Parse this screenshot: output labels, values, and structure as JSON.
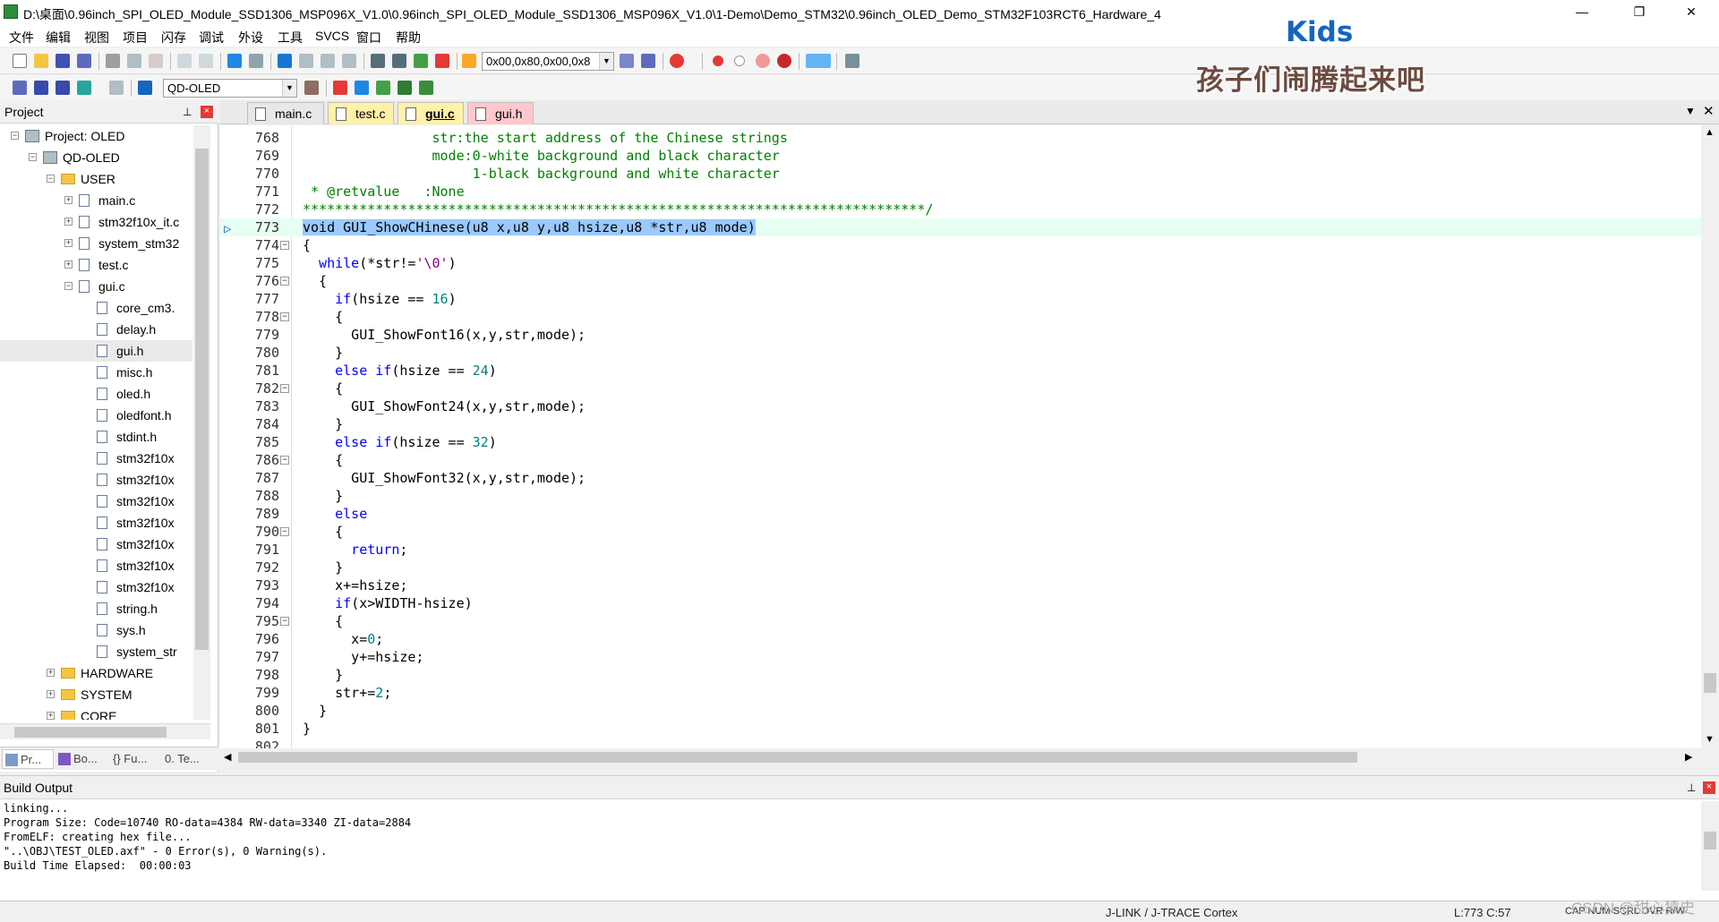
{
  "window": {
    "title": "D:\\桌面\\0.96inch_SPI_OLED_Module_SSD1306_MSP096X_V1.0\\0.96inch_SPI_OLED_Module_SSD1306_MSP096X_V1.0\\1-Demo\\Demo_STM32\\0.96inch_OLED_Demo_STM32F103RCT6_Hardware_4",
    "minimize": "—",
    "restore": "❐",
    "close": "✕"
  },
  "menu": [
    "文件",
    "编辑",
    "视图",
    "项目",
    "闪存",
    "调试",
    "外设",
    "工具",
    "SVCS",
    "窗口",
    "帮助"
  ],
  "toolbar": {
    "search_combo": "0x00,0x80,0x00,0x8",
    "target_combo": "QD-OLED"
  },
  "overlay": {
    "kids": "Kids",
    "kids_cn": "孩子们闹腾起来吧"
  },
  "project_panel": {
    "title": "Project",
    "pin": "📌",
    "close": "×",
    "tree": [
      {
        "label": "Project: OLED",
        "level": 0,
        "type": "proj",
        "exp": "−"
      },
      {
        "label": "QD-OLED",
        "level": 1,
        "type": "proj",
        "exp": "−"
      },
      {
        "label": "USER",
        "level": 2,
        "type": "folder",
        "exp": "−"
      },
      {
        "label": "main.c",
        "level": 3,
        "type": "file",
        "exp": "+"
      },
      {
        "label": "stm32f10x_it.c",
        "level": 3,
        "type": "file",
        "exp": "+"
      },
      {
        "label": "system_stm32",
        "level": 3,
        "type": "file",
        "exp": "+"
      },
      {
        "label": "test.c",
        "level": 3,
        "type": "file",
        "exp": "+"
      },
      {
        "label": "gui.c",
        "level": 3,
        "type": "file",
        "exp": "−"
      },
      {
        "label": "core_cm3.",
        "level": 4,
        "type": "file",
        "exp": ""
      },
      {
        "label": "delay.h",
        "level": 4,
        "type": "file",
        "exp": ""
      },
      {
        "label": "gui.h",
        "level": 4,
        "type": "file",
        "exp": ""
      },
      {
        "label": "misc.h",
        "level": 4,
        "type": "file",
        "exp": ""
      },
      {
        "label": "oled.h",
        "level": 4,
        "type": "file",
        "exp": ""
      },
      {
        "label": "oledfont.h",
        "level": 4,
        "type": "file",
        "exp": ""
      },
      {
        "label": "stdint.h",
        "level": 4,
        "type": "file",
        "exp": ""
      },
      {
        "label": "stm32f10x",
        "level": 4,
        "type": "file",
        "exp": ""
      },
      {
        "label": "stm32f10x",
        "level": 4,
        "type": "file",
        "exp": ""
      },
      {
        "label": "stm32f10x",
        "level": 4,
        "type": "file",
        "exp": ""
      },
      {
        "label": "stm32f10x",
        "level": 4,
        "type": "file",
        "exp": ""
      },
      {
        "label": "stm32f10x",
        "level": 4,
        "type": "file",
        "exp": ""
      },
      {
        "label": "stm32f10x",
        "level": 4,
        "type": "file",
        "exp": ""
      },
      {
        "label": "stm32f10x",
        "level": 4,
        "type": "file",
        "exp": ""
      },
      {
        "label": "string.h",
        "level": 4,
        "type": "file",
        "exp": ""
      },
      {
        "label": "sys.h",
        "level": 4,
        "type": "file",
        "exp": ""
      },
      {
        "label": "system_str",
        "level": 4,
        "type": "file",
        "exp": ""
      },
      {
        "label": "HARDWARE",
        "level": 2,
        "type": "folder",
        "exp": "+"
      },
      {
        "label": "SYSTEM",
        "level": 2,
        "type": "folder",
        "exp": "+"
      },
      {
        "label": "CORE",
        "level": 2,
        "type": "folder",
        "exp": "+"
      }
    ],
    "tabs": [
      "Pr...",
      "Bo...",
      "{} Fu...",
      "0. Te..."
    ]
  },
  "editor": {
    "tabs": [
      {
        "label": "main.c",
        "active": false,
        "color": "#e8e8e8"
      },
      {
        "label": "test.c",
        "active": false,
        "color": "#fff2a8"
      },
      {
        "label": "gui.c",
        "active": true,
        "color": "#fff2a8"
      },
      {
        "label": "gui.h",
        "active": false,
        "color": "#ffc8cc"
      }
    ],
    "lines": [
      {
        "n": "768",
        "fold": "",
        "segs": [
          [
            "com",
            "                str:the start address of the Chinese strings"
          ]
        ]
      },
      {
        "n": "769",
        "fold": "",
        "segs": [
          [
            "com",
            "                mode:0-white background and black character"
          ]
        ]
      },
      {
        "n": "770",
        "fold": "",
        "segs": [
          [
            "com",
            "                     1-black background and white character"
          ]
        ]
      },
      {
        "n": "771",
        "fold": "",
        "segs": [
          [
            "com",
            " * @retvalue   :None"
          ]
        ]
      },
      {
        "n": "772",
        "fold": "",
        "segs": [
          [
            "com",
            "*****************************************************************************/"
          ]
        ]
      },
      {
        "n": "773",
        "fold": "",
        "segs": [
          [
            "sel",
            "void GUI_ShowCHinese(u8 x,u8 y,u8 hsize,u8 *str,u8 mode)"
          ]
        ]
      },
      {
        "n": "774",
        "fold": "−",
        "segs": [
          [
            "",
            "{"
          ]
        ]
      },
      {
        "n": "775",
        "fold": "",
        "segs": [
          [
            "kw",
            "  while"
          ],
          [
            "",
            "(*str!="
          ],
          [
            "str",
            "'\\0'"
          ],
          [
            "",
            ")"
          ]
        ]
      },
      {
        "n": "776",
        "fold": "−",
        "segs": [
          [
            "",
            "  {"
          ]
        ]
      },
      {
        "n": "777",
        "fold": "",
        "segs": [
          [
            "kw",
            "    if"
          ],
          [
            "",
            "(hsize == "
          ],
          [
            "num",
            "16"
          ],
          [
            "",
            ")"
          ]
        ]
      },
      {
        "n": "778",
        "fold": "−",
        "segs": [
          [
            "",
            "    {"
          ]
        ]
      },
      {
        "n": "779",
        "fold": "",
        "segs": [
          [
            "",
            "      GUI_ShowFont16(x,y,str,mode);"
          ]
        ]
      },
      {
        "n": "780",
        "fold": "",
        "segs": [
          [
            "",
            "    }"
          ]
        ]
      },
      {
        "n": "781",
        "fold": "",
        "segs": [
          [
            "kw",
            "    else if"
          ],
          [
            "",
            "(hsize == "
          ],
          [
            "num",
            "24"
          ],
          [
            "",
            ")"
          ]
        ]
      },
      {
        "n": "782",
        "fold": "−",
        "segs": [
          [
            "",
            "    {"
          ]
        ]
      },
      {
        "n": "783",
        "fold": "",
        "segs": [
          [
            "",
            "      GUI_ShowFont24(x,y,str,mode);"
          ]
        ]
      },
      {
        "n": "784",
        "fold": "",
        "segs": [
          [
            "",
            "    }"
          ]
        ]
      },
      {
        "n": "785",
        "fold": "",
        "segs": [
          [
            "kw",
            "    else if"
          ],
          [
            "",
            "(hsize == "
          ],
          [
            "num",
            "32"
          ],
          [
            "",
            ")"
          ]
        ]
      },
      {
        "n": "786",
        "fold": "−",
        "segs": [
          [
            "",
            "    {"
          ]
        ]
      },
      {
        "n": "787",
        "fold": "",
        "segs": [
          [
            "",
            "      GUI_ShowFont32(x,y,str,mode);"
          ]
        ]
      },
      {
        "n": "788",
        "fold": "",
        "segs": [
          [
            "",
            "    }"
          ]
        ]
      },
      {
        "n": "789",
        "fold": "",
        "segs": [
          [
            "kw",
            "    else"
          ]
        ]
      },
      {
        "n": "790",
        "fold": "−",
        "segs": [
          [
            "",
            "    {"
          ]
        ]
      },
      {
        "n": "791",
        "fold": "",
        "segs": [
          [
            "kw",
            "      return"
          ],
          [
            "",
            ";"
          ]
        ]
      },
      {
        "n": "792",
        "fold": "",
        "segs": [
          [
            "",
            "    }"
          ]
        ]
      },
      {
        "n": "793",
        "fold": "",
        "segs": [
          [
            "",
            "    x+=hsize;"
          ]
        ]
      },
      {
        "n": "794",
        "fold": "",
        "segs": [
          [
            "kw",
            "    if"
          ],
          [
            "",
            "(x>WIDTH-hsize)"
          ]
        ]
      },
      {
        "n": "795",
        "fold": "−",
        "segs": [
          [
            "",
            "    {"
          ]
        ]
      },
      {
        "n": "796",
        "fold": "",
        "segs": [
          [
            "",
            "      x="
          ],
          [
            "num",
            "0"
          ],
          [
            "",
            ";"
          ]
        ]
      },
      {
        "n": "797",
        "fold": "",
        "segs": [
          [
            "",
            "      y+=hsize;"
          ]
        ]
      },
      {
        "n": "798",
        "fold": "",
        "segs": [
          [
            "",
            "    }"
          ]
        ]
      },
      {
        "n": "799",
        "fold": "",
        "segs": [
          [
            "",
            "    str+="
          ],
          [
            "num",
            "2"
          ],
          [
            "",
            ";"
          ]
        ]
      },
      {
        "n": "800",
        "fold": "",
        "segs": [
          [
            "",
            "  }"
          ]
        ]
      },
      {
        "n": "801",
        "fold": "",
        "segs": [
          [
            "",
            "}"
          ]
        ]
      },
      {
        "n": "802",
        "fold": "",
        "segs": [
          [
            "",
            ""
          ]
        ]
      }
    ],
    "current_line": "773"
  },
  "build_output": {
    "title": "Build Output",
    "lines": [
      "linking...",
      "Program Size: Code=10740 RO-data=4384 RW-data=3340 ZI-data=2884",
      "FromELF: creating hex file...",
      "\"..\\OBJ\\TEST_OLED.axf\" - 0 Error(s), 0 Warning(s).",
      "Build Time Elapsed:  00:00:03"
    ]
  },
  "statusbar": {
    "debugger": "J-LINK / J-TRACE Cortex",
    "position": "L:773 C:57",
    "flags": "CAP NUM SCRL OVR R/W"
  },
  "watermark": "CSDN @甜心猿史"
}
